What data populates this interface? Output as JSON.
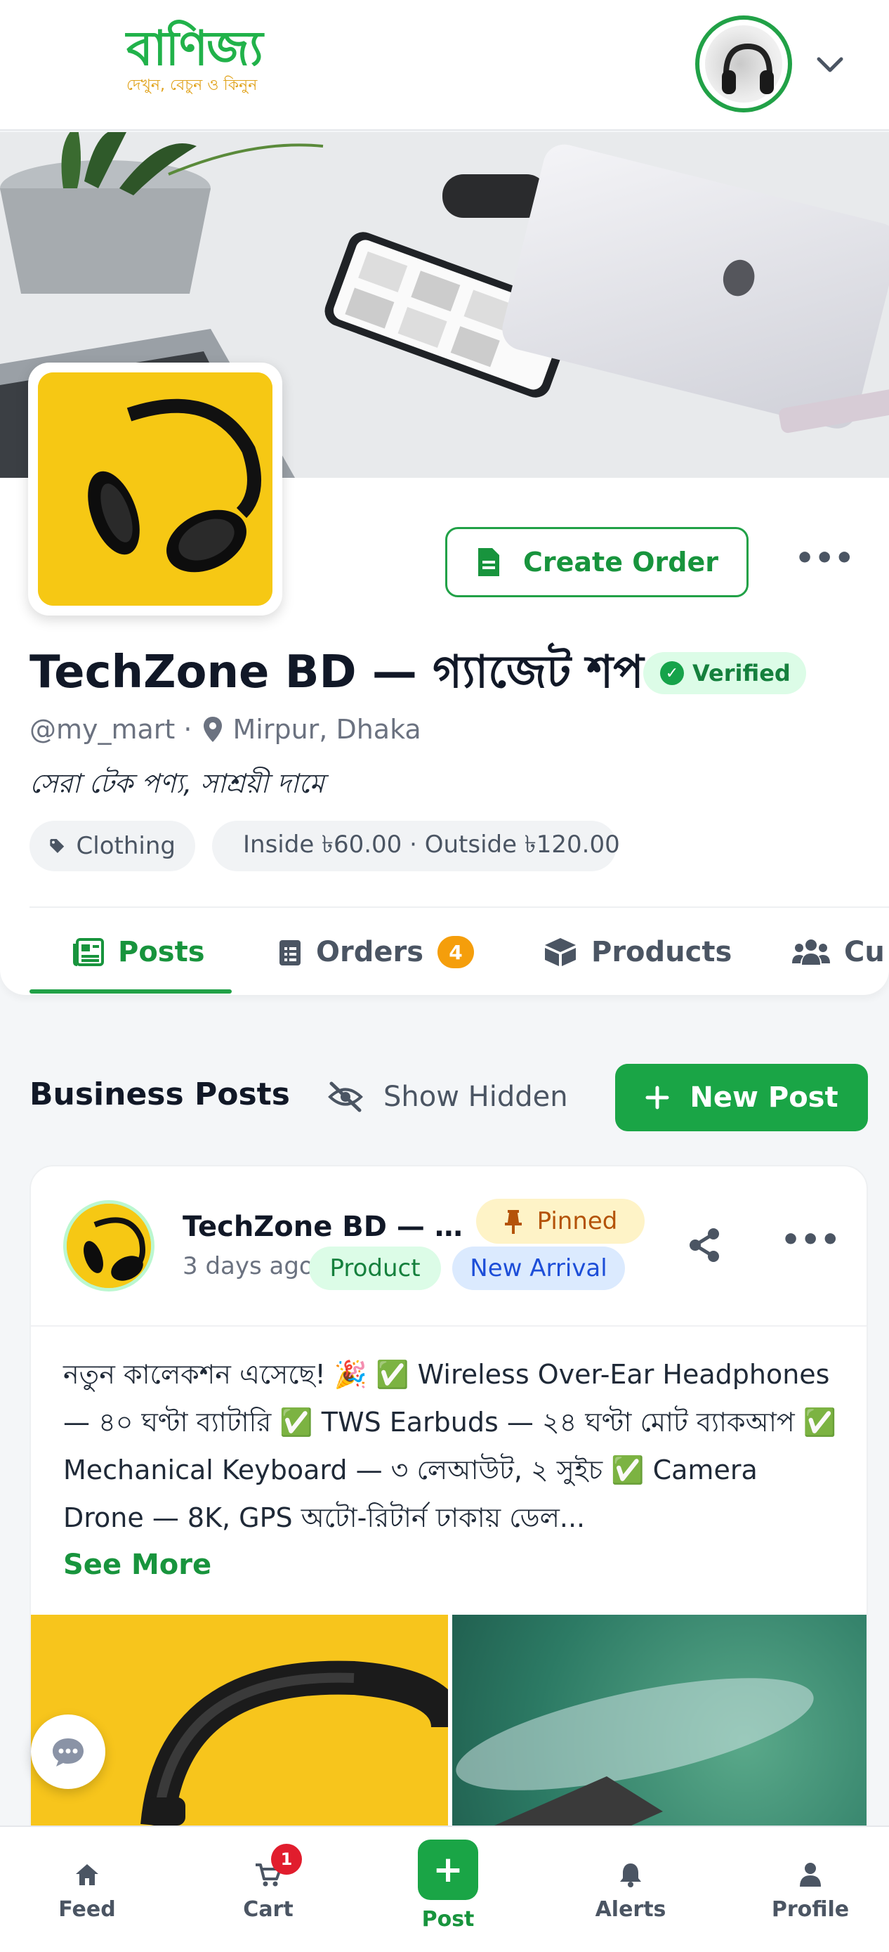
{
  "header": {
    "brand": "বাণিজ্য",
    "tagline": "দেখুন, বেচুন ও কিনুন"
  },
  "shop": {
    "name": "TechZone BD — গ্যাজেট শপ",
    "verified_label": "Verified",
    "handle": "@my_mart ·",
    "location": "Mirpur, Dhaka",
    "bio": "সেরা টেক পণ্য, সাশ্রয়ী দামে",
    "category": "Clothing",
    "delivery": "Inside ৳60.00 · Outside ৳120.00",
    "create_order_label": "Create Order"
  },
  "tabs": [
    {
      "label": "Posts",
      "active": true
    },
    {
      "label": "Orders",
      "badge": "4"
    },
    {
      "label": "Products"
    },
    {
      "label": "Cu"
    }
  ],
  "section": {
    "title": "Business Posts",
    "show_hidden_label": "Show Hidden",
    "new_post_label": "New Post"
  },
  "post": {
    "author": "TechZone BD — গ্যাজেট শপ",
    "pinned_label": "Pinned",
    "time": "3 days ago",
    "tags": [
      "Product",
      "New Arrival"
    ],
    "body": "নতুন কালেকশন এসেছে! 🎉 ✅ Wireless Over-Ear Headphones — ৪০ ঘণ্টা ব্যাটারি ✅ TWS Earbuds — ২৪ ঘণ্টা মোট ব্যাকআপ ✅ Mechanical Keyboard — ৩ লেআউট, ২ সুইচ ✅ Camera Drone — 8K, GPS অটো-রিটার্ন ঢাকায় ডেল...",
    "see_more_label": "See More"
  },
  "bottom_nav": [
    {
      "label": "Feed",
      "icon": "home-icon"
    },
    {
      "label": "Cart",
      "icon": "cart-icon",
      "badge": "1"
    },
    {
      "label": "Post",
      "icon": "plus-icon"
    },
    {
      "label": "Alerts",
      "icon": "bell-icon"
    },
    {
      "label": "Profile",
      "icon": "user-icon"
    }
  ],
  "colors": {
    "primary": "#1aa546",
    "verified_bg": "#dcfce7",
    "pinned_bg": "#fef3c7",
    "orders_badge": "#f59e0b",
    "cart_badge": "#e11d2d"
  }
}
